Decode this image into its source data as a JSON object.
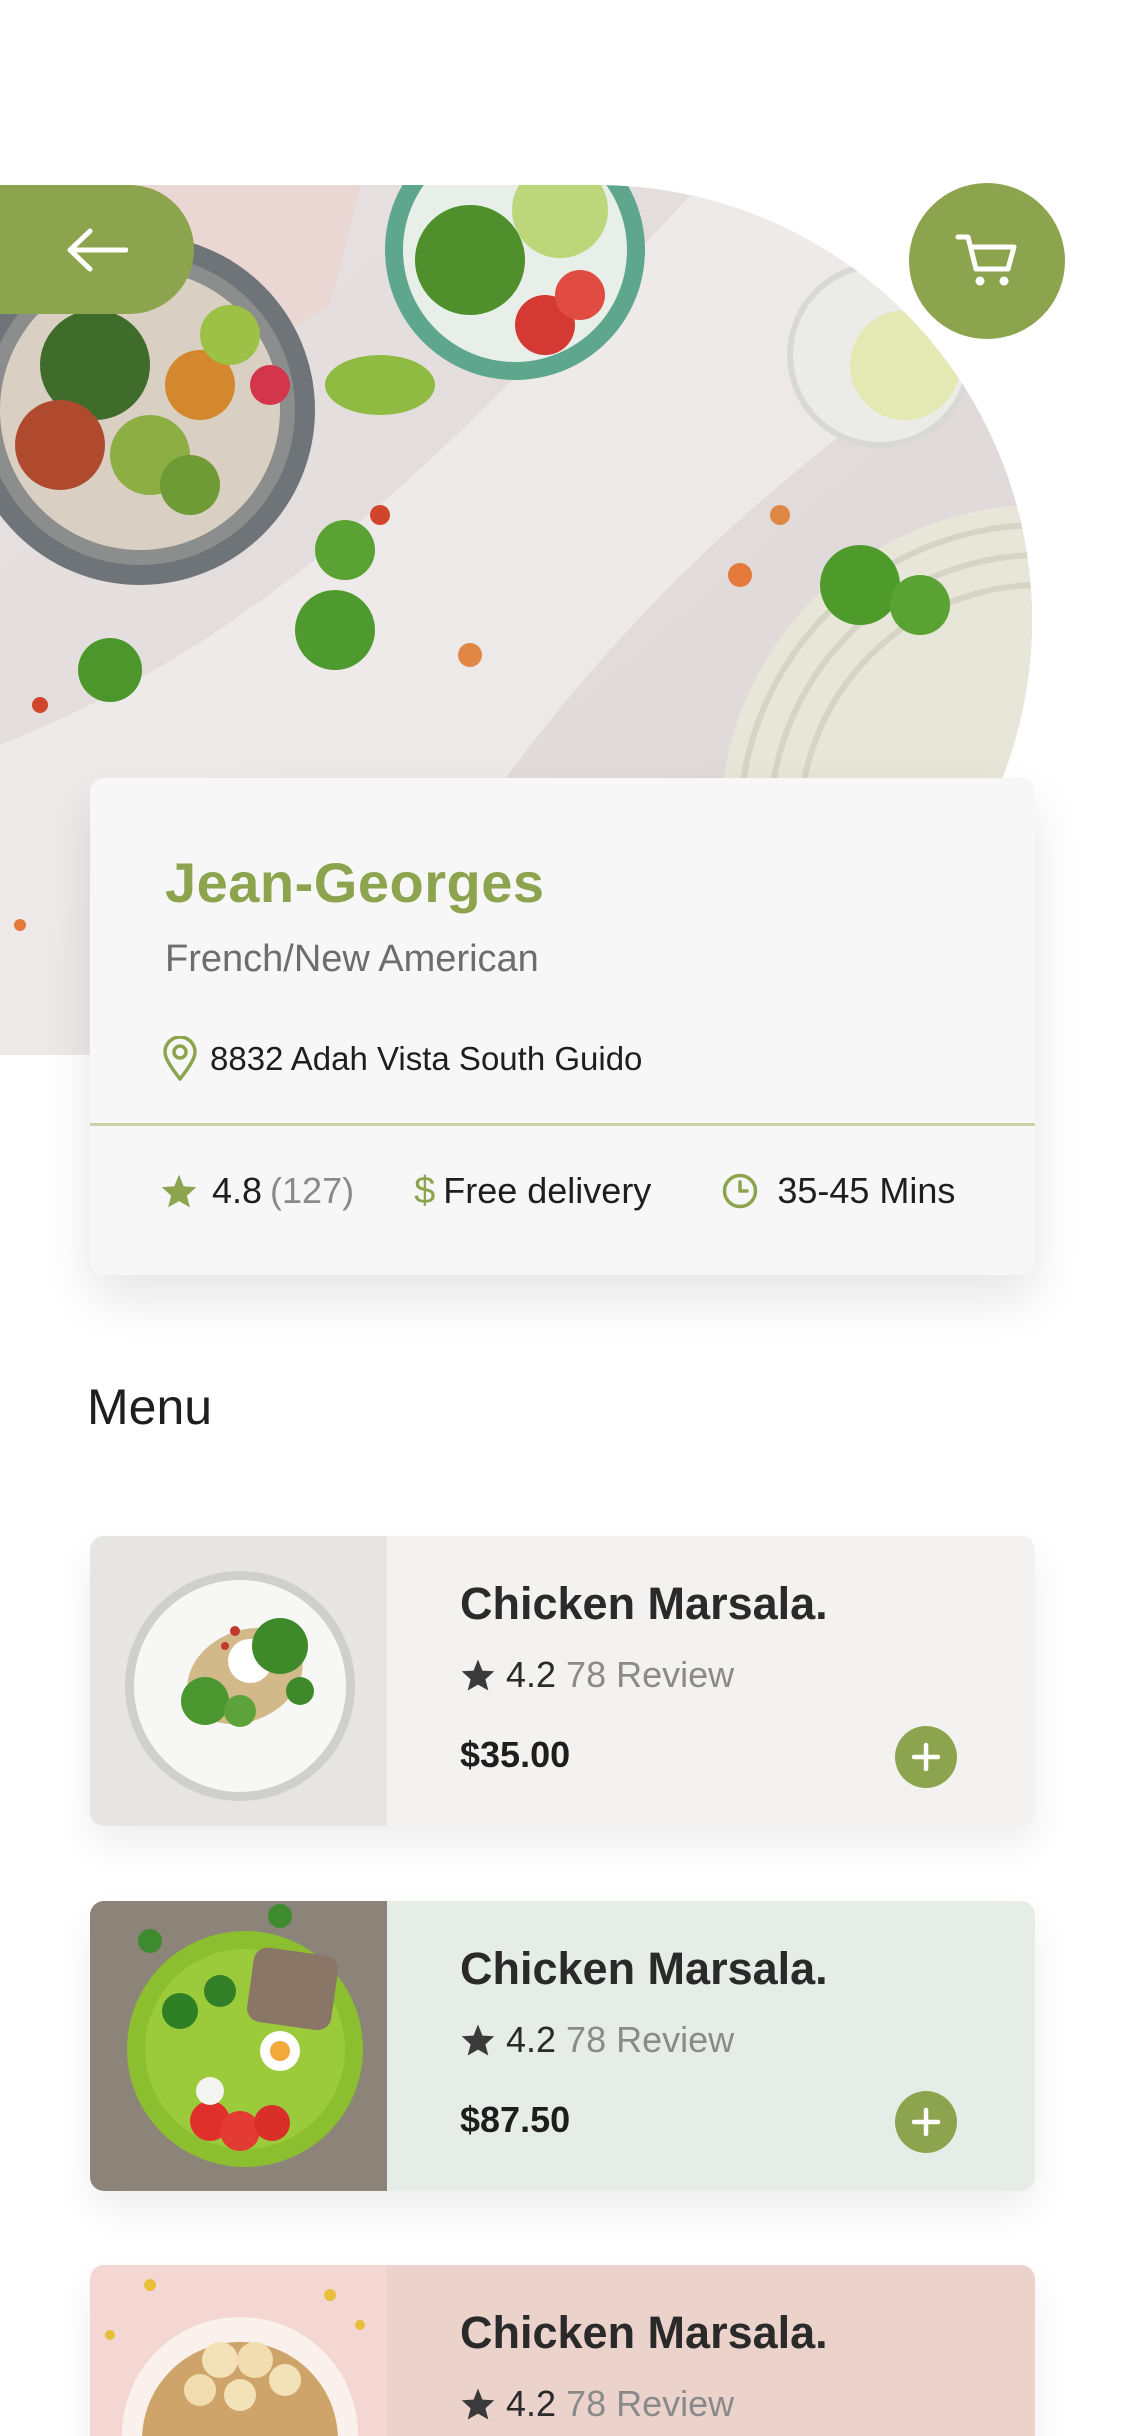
{
  "restaurant": {
    "name": "Jean-Georges",
    "cuisine": "French/New American",
    "address": "8832 Adah Vista South Guido",
    "rating": "4.8",
    "rating_count": "(127)",
    "delivery_symbol": "$",
    "delivery": "Free delivery",
    "time": "35-45 Mins"
  },
  "icons": {
    "back": "arrow-left-icon",
    "cart": "cart-icon",
    "location": "location-pin-icon",
    "star": "star-icon",
    "clock": "clock-icon",
    "add": "plus-icon"
  },
  "colors": {
    "accent": "#8da44e",
    "card_1_bg": "#f3f2f0",
    "card_2_bg": "#e5ede6",
    "card_3_bg": "#ebd3cc"
  },
  "menu": {
    "title": "Menu",
    "items": [
      {
        "name": "Chicken Marsala.",
        "rating": "4.2",
        "review": "78 Review",
        "price": "$35.00"
      },
      {
        "name": "Chicken Marsala.",
        "rating": "4.2",
        "review": "78 Review",
        "price": "$87.50"
      },
      {
        "name": "Chicken Marsala.",
        "rating": "4.2",
        "review": "78 Review",
        "price": ""
      }
    ]
  }
}
